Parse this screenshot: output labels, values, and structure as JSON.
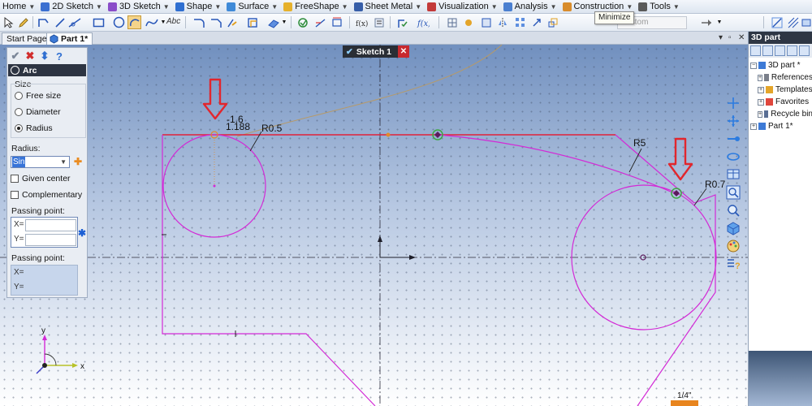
{
  "menu": {
    "items": [
      {
        "label": "Home",
        "icon": "home-icon",
        "color": "#ffffff"
      },
      {
        "label": "2D Sketch",
        "icon": "sketch-2d-icon",
        "color": "#3b6fd1"
      },
      {
        "label": "3D Sketch",
        "icon": "sketch-3d-icon",
        "color": "#8a4dc9"
      },
      {
        "label": "Shape",
        "icon": "shape-icon",
        "color": "#2f6fd1"
      },
      {
        "label": "Surface",
        "icon": "surface-icon",
        "color": "#3f8ad8"
      },
      {
        "label": "FreeShape",
        "icon": "freeshape-icon",
        "color": "#e6b12c"
      },
      {
        "label": "Sheet Metal",
        "icon": "sheet-metal-icon",
        "color": "#375ea8"
      },
      {
        "label": "Visualization",
        "icon": "visualization-icon",
        "color": "#c33a3a"
      },
      {
        "label": "Analysis",
        "icon": "analysis-icon",
        "color": "#4a7fd0"
      },
      {
        "label": "Construction",
        "icon": "construction-icon",
        "color": "#d88c2c"
      },
      {
        "label": "Tools",
        "icon": "tools-icon",
        "color": "#5a5a5a"
      }
    ]
  },
  "tooltip": {
    "text": "Minimize"
  },
  "toolbar": {
    "combo_placeholder": "Custom",
    "text_tool_label": "Abc"
  },
  "tabs": [
    {
      "label": "Start Page",
      "active": false
    },
    {
      "label": "Part 1*",
      "active": true
    }
  ],
  "sketch": {
    "label": "Sketch 1"
  },
  "arc_panel": {
    "title": "Arc",
    "size_group_label": "Size",
    "size_options": [
      {
        "label": "Free size",
        "selected": false
      },
      {
        "label": "Diameter",
        "selected": false
      },
      {
        "label": "Radius",
        "selected": true
      }
    ],
    "radius_label": "Radius:",
    "radius_value": "Sin",
    "given_center_label": "Given center",
    "complementary_label": "Complementary",
    "passing_point_1": {
      "label": "Passing point:",
      "x_label": "X=",
      "y_label": "Y="
    },
    "passing_point_2": {
      "label": "Passing point:",
      "x_label": "X=",
      "y_label": "Y="
    }
  },
  "canvas": {
    "dimension_labels": {
      "coord_x": "-1.6",
      "coord_y": "1.188",
      "r_small": "R0.5",
      "r_large": "R5",
      "r_right": "R0.7"
    },
    "axis_labels": {
      "y": "y",
      "x": "x"
    },
    "scale_label": "1/4\"",
    "colors": {
      "sketch_line": "#d32ad6",
      "edge_red": "#e0203a",
      "arrow_red": "#e2262d",
      "curve_tan": "#b79a68"
    }
  },
  "side_panel": {
    "title": "3D part",
    "tree": [
      {
        "label": "3D part *",
        "level": 0,
        "expanded": true
      },
      {
        "label": "References",
        "level": 1
      },
      {
        "label": "Templates",
        "level": 1
      },
      {
        "label": "Favorites",
        "level": 1
      },
      {
        "label": "Recycle bin",
        "level": 1
      },
      {
        "label": "Part 1*",
        "level": 0
      }
    ]
  }
}
